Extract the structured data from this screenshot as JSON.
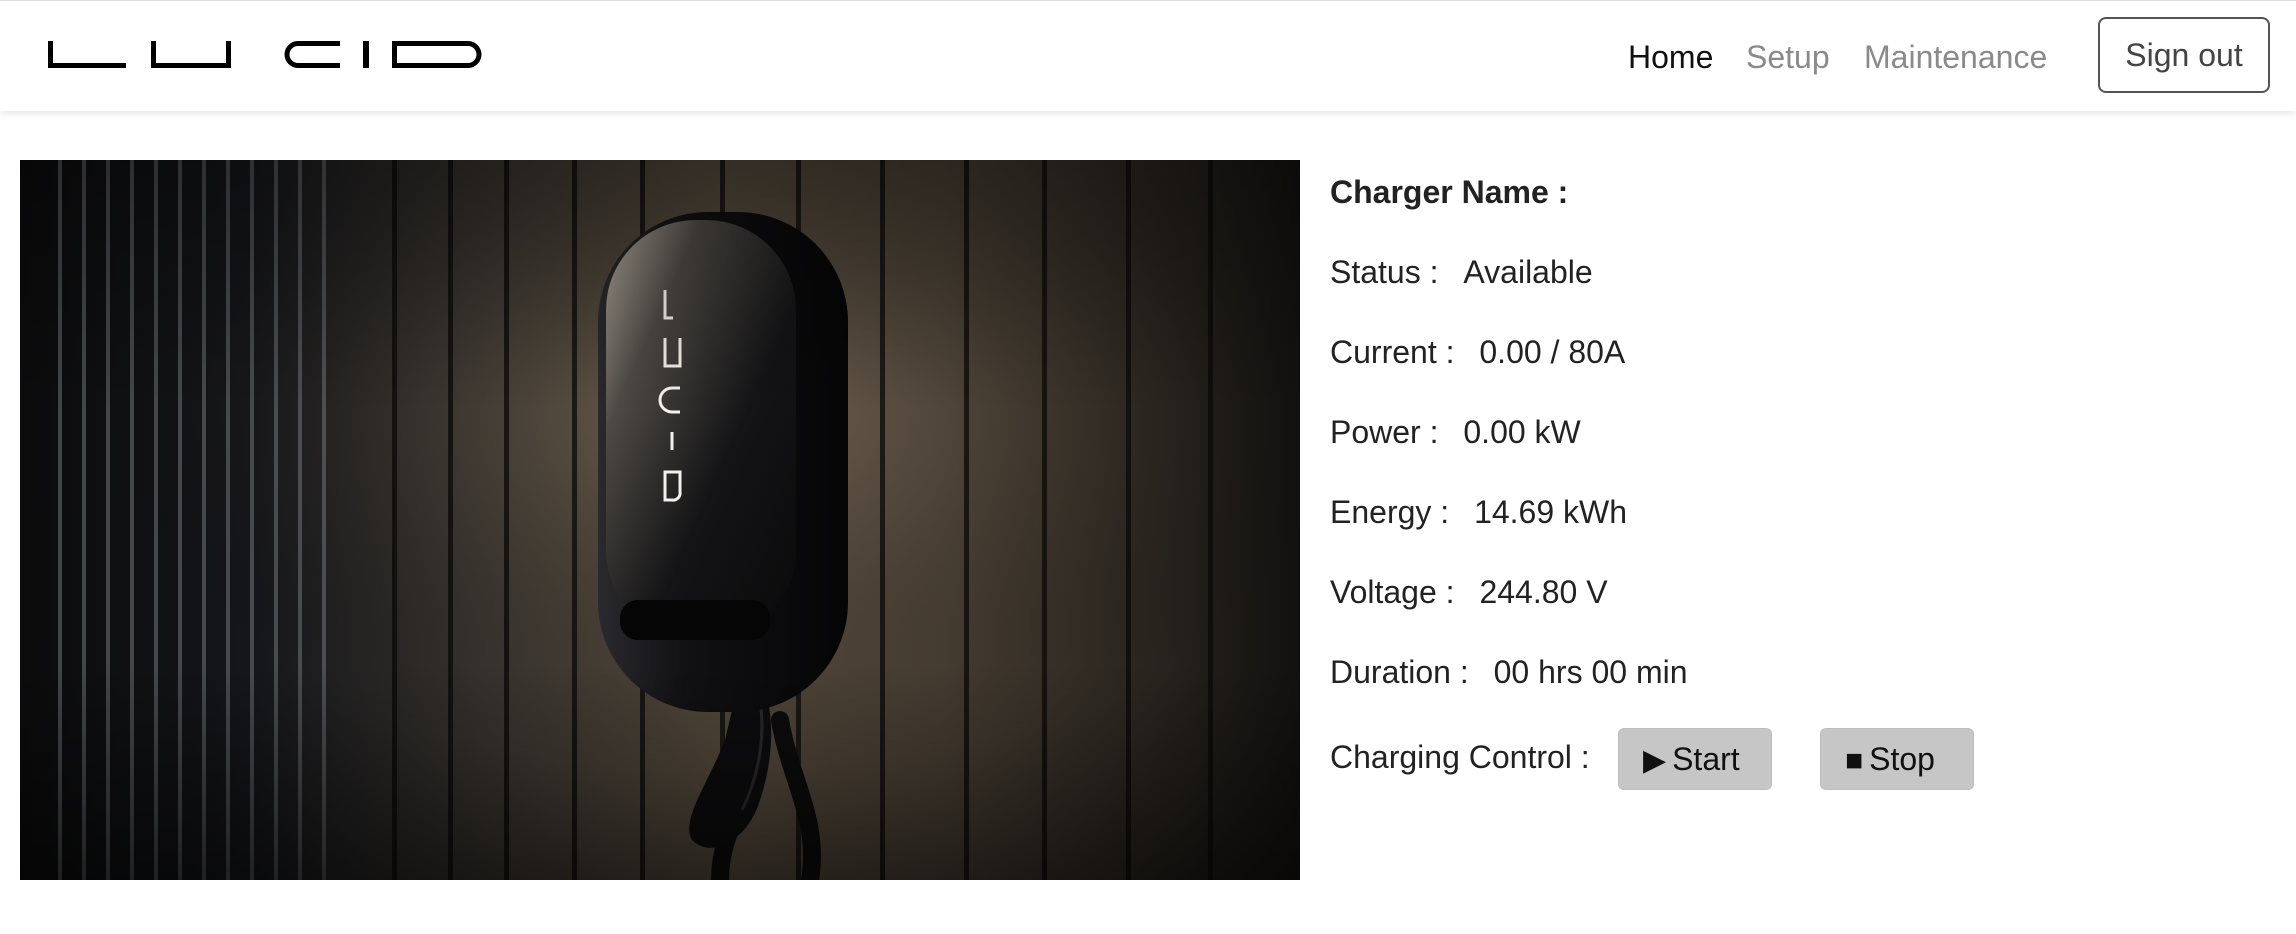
{
  "brand": {
    "logo_icon": "lucid-wordmark-logo",
    "logo_text": "LUCID"
  },
  "nav": {
    "links": [
      {
        "label": "Home",
        "active": true
      },
      {
        "label": "Setup",
        "active": false
      },
      {
        "label": "Maintenance",
        "active": false
      }
    ],
    "sign_out_label": "Sign out"
  },
  "hero": {
    "icon": "wall-charger-photo"
  },
  "charger": {
    "name_label": "Charger Name :",
    "name_value": "",
    "status_label": "Status :",
    "status_value": "Available",
    "current_label": "Current :",
    "current_value": "0.00 / 80A",
    "power_label": "Power :",
    "power_value": "0.00 kW",
    "energy_label": "Energy :",
    "energy_value": "14.69 kWh",
    "voltage_label": "Voltage :",
    "voltage_value": "244.80 V",
    "duration_label": "Duration :",
    "duration_value": "00 hrs 00 min"
  },
  "controls": {
    "label": "Charging Control :",
    "start_label": "Start",
    "start_icon": "play-icon",
    "stop_label": "Stop",
    "stop_icon": "stop-icon"
  },
  "colors": {
    "active_nav": "#111111",
    "inactive_nav": "#8a8a8a",
    "button_bg": "#c6c6c6"
  }
}
